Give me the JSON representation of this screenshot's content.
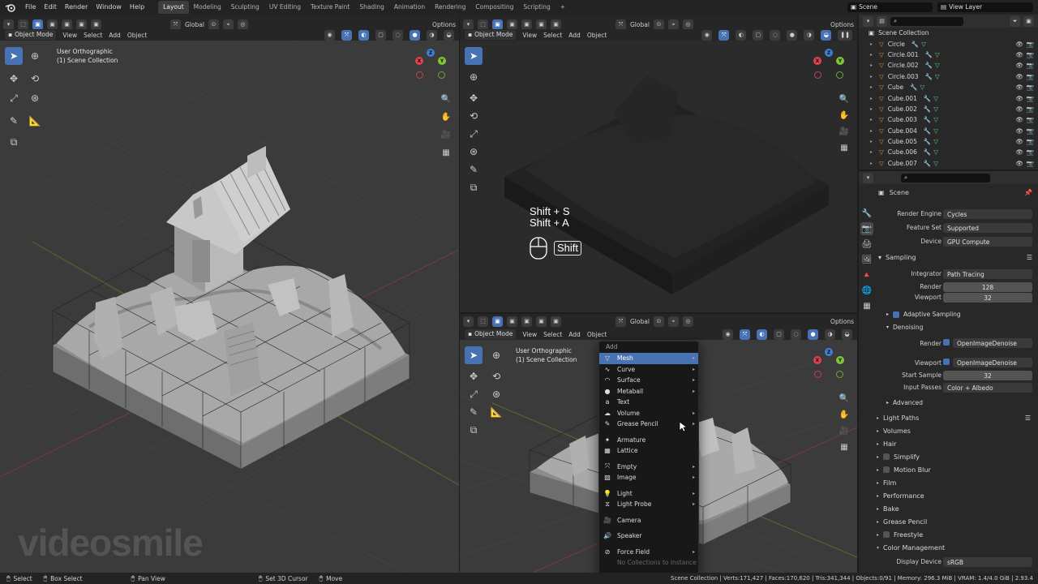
{
  "topbar": {
    "menus": [
      "File",
      "Edit",
      "Render",
      "Window",
      "Help"
    ],
    "workspaces": [
      "Layout",
      "Modeling",
      "Sculpting",
      "UV Editing",
      "Texture Paint",
      "Shading",
      "Animation",
      "Rendering",
      "Compositing",
      "Scripting"
    ],
    "active_workspace": "Layout",
    "add_tab": "+",
    "scene_name": "Scene",
    "view_layer": "View Layer"
  },
  "header": {
    "transform_orientation": "Global",
    "options": "Options",
    "object_mode": "Object Mode",
    "menus": [
      "View",
      "Select",
      "Add",
      "Object"
    ]
  },
  "viewport_left": {
    "info_line1": "User Orthographic",
    "info_line2": "(1) Scene Collection"
  },
  "viewport_bottom": {
    "info_line1": "User Orthographic",
    "info_line2": "(1) Scene Collection"
  },
  "gizmo": {
    "x": "X",
    "y": "Y",
    "z": "Z"
  },
  "shortcut_overlay": {
    "line1": "Shift + S",
    "line2": "Shift + A",
    "key": "Shift"
  },
  "watermark": "videosmile",
  "add_menu": {
    "title": "Add",
    "items": [
      {
        "label": "Mesh",
        "icon": "mesh-icon",
        "submenu": true,
        "highlighted": true
      },
      {
        "label": "Curve",
        "icon": "curve-icon",
        "submenu": true
      },
      {
        "label": "Surface",
        "icon": "surface-icon",
        "submenu": true
      },
      {
        "label": "Metaball",
        "icon": "metaball-icon",
        "submenu": true
      },
      {
        "label": "Text",
        "icon": "text-icon",
        "submenu": false
      },
      {
        "label": "Volume",
        "icon": "volume-icon",
        "submenu": true
      },
      {
        "label": "Grease Pencil",
        "icon": "grease-pencil-icon",
        "submenu": true
      },
      {
        "label": "Armature",
        "icon": "armature-icon",
        "submenu": false
      },
      {
        "label": "Lattice",
        "icon": "lattice-icon",
        "submenu": false
      },
      {
        "label": "Empty",
        "icon": "empty-icon",
        "submenu": true
      },
      {
        "label": "Image",
        "icon": "image-icon",
        "submenu": true
      },
      {
        "label": "Light",
        "icon": "light-icon",
        "submenu": true
      },
      {
        "label": "Light Probe",
        "icon": "light-probe-icon",
        "submenu": true
      },
      {
        "label": "Camera",
        "icon": "camera-icon",
        "submenu": false
      },
      {
        "label": "Speaker",
        "icon": "speaker-icon",
        "submenu": false
      },
      {
        "label": "Force Field",
        "icon": "force-field-icon",
        "submenu": true
      },
      {
        "label": "No Collections to Instance",
        "icon": "",
        "submenu": false,
        "disabled": true
      }
    ]
  },
  "outliner": {
    "root": "Scene Collection",
    "items": [
      "Circle",
      "Circle.001",
      "Circle.002",
      "Circle.003",
      "Cube",
      "Cube.001",
      "Cube.002",
      "Cube.003",
      "Cube.004",
      "Cube.005",
      "Cube.006",
      "Cube.007"
    ]
  },
  "properties": {
    "context": "Scene",
    "render_engine_label": "Render Engine",
    "render_engine": "Cycles",
    "feature_set_label": "Feature Set",
    "feature_set": "Supported",
    "device_label": "Device",
    "device": "GPU Compute",
    "sampling": "Sampling",
    "integrator_label": "Integrator",
    "integrator": "Path Tracing",
    "render_label": "Render",
    "render_samples": "128",
    "viewport_label": "Viewport",
    "viewport_samples": "32",
    "adaptive_sampling": "Adaptive Sampling",
    "denoising": "Denoising",
    "denoise_render_label": "Render",
    "denoise_render": "OpenImageDenoise",
    "denoise_viewport_label": "Viewport",
    "denoise_viewport": "OpenImageDenoise",
    "start_sample_label": "Start Sample",
    "start_sample": "32",
    "input_passes_label": "Input Passes",
    "input_passes": "Color + Albedo",
    "advanced": "Advanced",
    "panels": [
      "Light Paths",
      "Volumes",
      "Hair",
      "Simplify",
      "Motion Blur",
      "Film",
      "Performance",
      "Bake",
      "Grease Pencil",
      "Freestyle",
      "Color Management"
    ],
    "display_device_label": "Display Device",
    "display_device": "sRGB"
  },
  "statusbar": {
    "select": "Select",
    "box_select": "Box Select",
    "pan_view": "Pan View",
    "set_3d_cursor": "Set 3D Cursor",
    "move": "Move",
    "stats": "Scene Collection | Verts:171,427 | Faces:170,620 | Tris:341,344 | Objects:0/91 | Memory: 296.3 MiB | VRAM: 1.4/4.0 GiB | 2.93.4"
  }
}
